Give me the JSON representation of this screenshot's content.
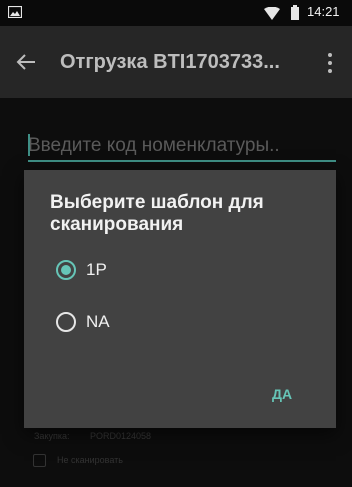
{
  "status_bar": {
    "time": "14:21",
    "icons": [
      "image-icon",
      "wifi-icon",
      "battery-icon"
    ]
  },
  "app_bar": {
    "title": "Отгрузка BTI1703733...",
    "back_icon": "back-arrow-icon",
    "menu_icon": "overflow-menu-icon"
  },
  "screen": {
    "code_input": {
      "placeholder": "Введите код номенклатуры.."
    },
    "purchase": {
      "label": "Закупка:",
      "value": "PORD0124058"
    },
    "no_scan": {
      "label": "Не сканировать"
    }
  },
  "dialog": {
    "title": "Выберите шаблон для сканирования",
    "options": [
      {
        "label": "1P",
        "selected": true
      },
      {
        "label": "NA",
        "selected": false
      }
    ],
    "ok_label": "ДА"
  },
  "colors": {
    "accent": "#66c5b7",
    "dialog_bg": "#424242",
    "app_bar_bg": "#262626"
  }
}
